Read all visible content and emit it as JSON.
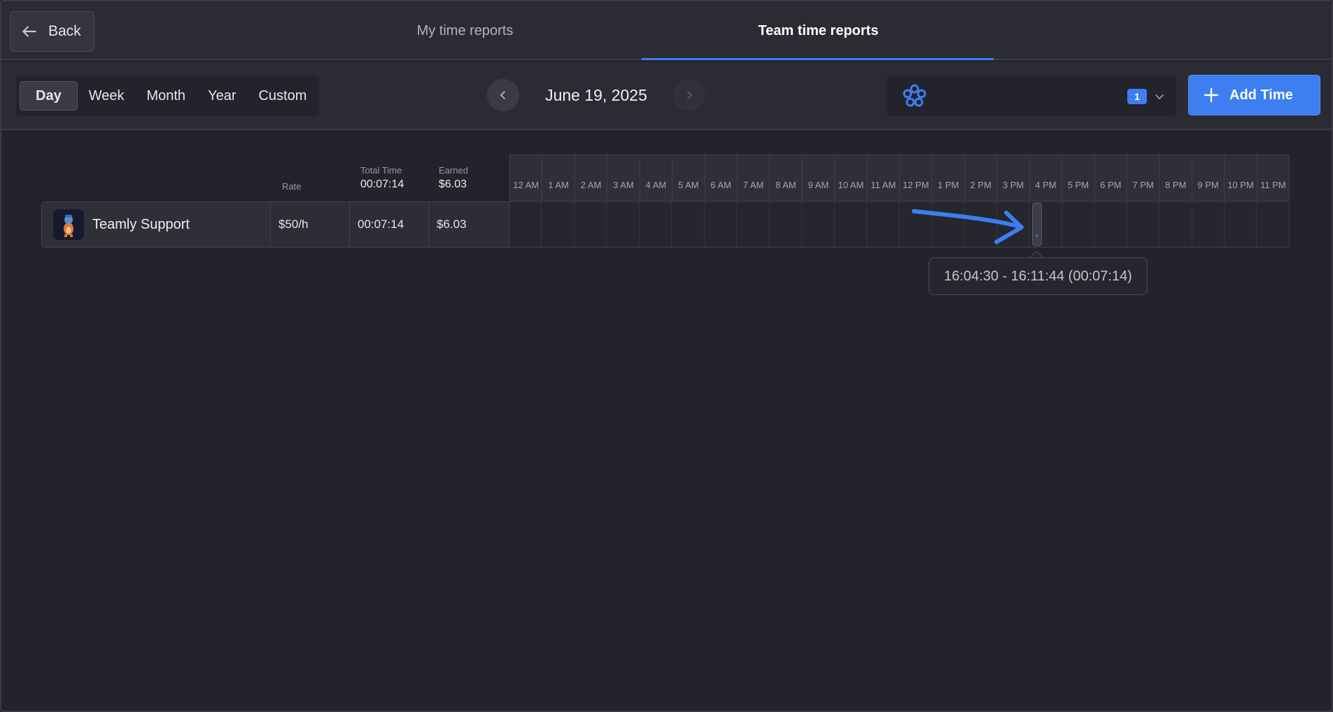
{
  "header": {
    "back_label": "Back",
    "tabs": [
      {
        "label": "My time reports",
        "active": false
      },
      {
        "label": "Team time reports",
        "active": true
      }
    ]
  },
  "toolbar": {
    "periods": [
      "Day",
      "Week",
      "Month",
      "Year",
      "Custom"
    ],
    "active_period": "Day",
    "date": "June 19, 2025",
    "team_badge": "1",
    "add_time_label": "Add Time"
  },
  "table": {
    "columns": {
      "rate": "Rate",
      "total_time": "Total Time",
      "total_time_value": "00:07:14",
      "earned": "Earned",
      "earned_value": "$6.03"
    },
    "rows": [
      {
        "member": "Teamly Support",
        "rate": "$50/h",
        "total_time": "00:07:14",
        "earned": "$6.03"
      }
    ]
  },
  "timeline": {
    "hours": [
      "12 AM",
      "1 AM",
      "2 AM",
      "3 AM",
      "4 AM",
      "5 AM",
      "6 AM",
      "7 AM",
      "8 AM",
      "9 AM",
      "10 AM",
      "11 AM",
      "12 PM",
      "1 PM",
      "2 PM",
      "3 PM",
      "4 PM",
      "5 PM",
      "6 PM",
      "7 PM",
      "8 PM",
      "9 PM",
      "10 PM",
      "11 PM"
    ],
    "tooltip": "16:04:30 - 16:11:44 (00:07:14)"
  },
  "colors": {
    "accent": "#3d7ef0",
    "background": "#22232b",
    "panel": "#2a2b33"
  }
}
